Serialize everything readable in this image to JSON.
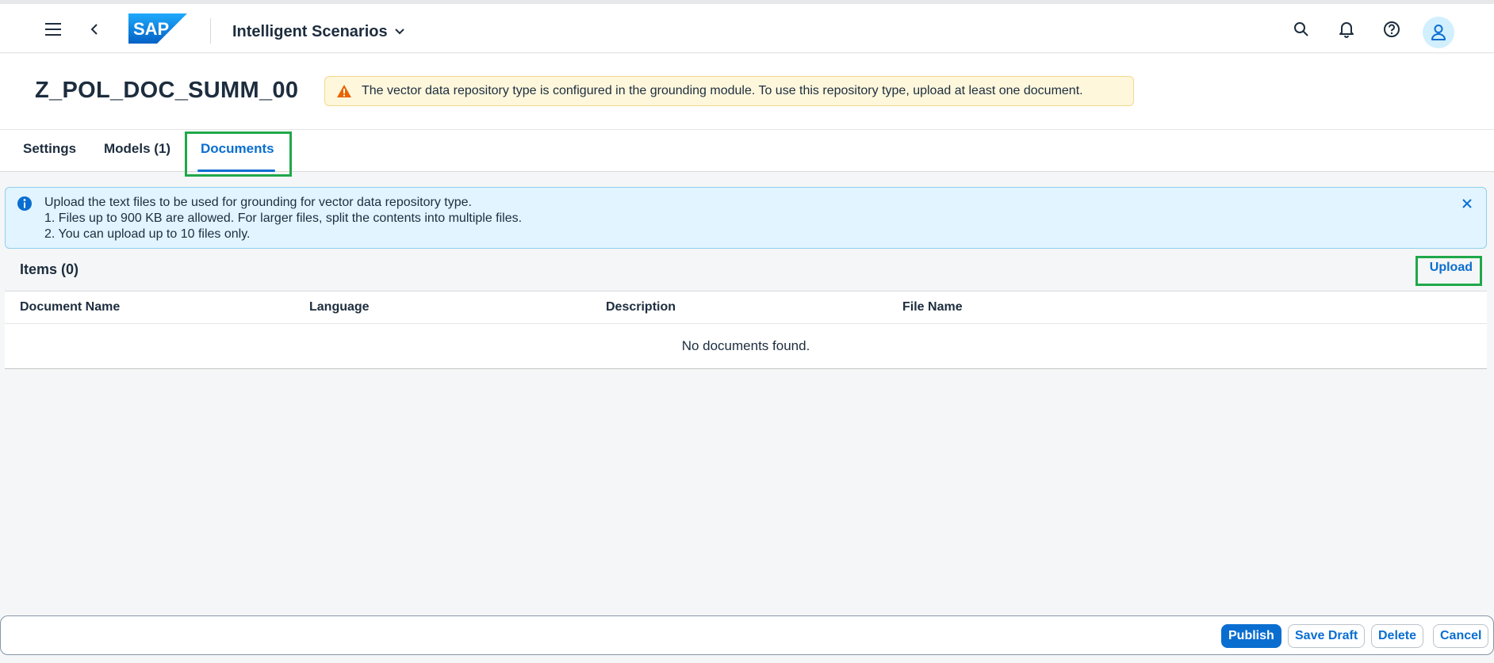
{
  "shell": {
    "app_title": "Intelligent Scenarios",
    "logo_text": "SAP",
    "colors": {
      "accent": "#0a6ed1",
      "avatar_bg": "#d1efff"
    }
  },
  "header": {
    "object_title": "Z_POL_DOC_SUMM_00",
    "warning_message": "The vector data repository type is configured in the grounding module. To use this repository type, upload at least one document."
  },
  "tabs": [
    {
      "label": "Settings"
    },
    {
      "label": "Models (1)"
    },
    {
      "label": "Documents"
    }
  ],
  "info": {
    "lines": [
      "Upload the text files to be used for grounding for vector data repository type.",
      "1. Files up to 900 KB are allowed. For larger files, split the contents into multiple files.",
      "2. You can upload up to 10 files only."
    ]
  },
  "table": {
    "title": "Items (0)",
    "upload_label": "Upload",
    "columns": [
      "Document Name",
      "Language",
      "Description",
      "File Name"
    ],
    "empty_text": "No documents found."
  },
  "footer": {
    "publish_label": "Publish",
    "save_draft_label": "Save Draft",
    "delete_label": "Delete",
    "cancel_label": "Cancel"
  }
}
